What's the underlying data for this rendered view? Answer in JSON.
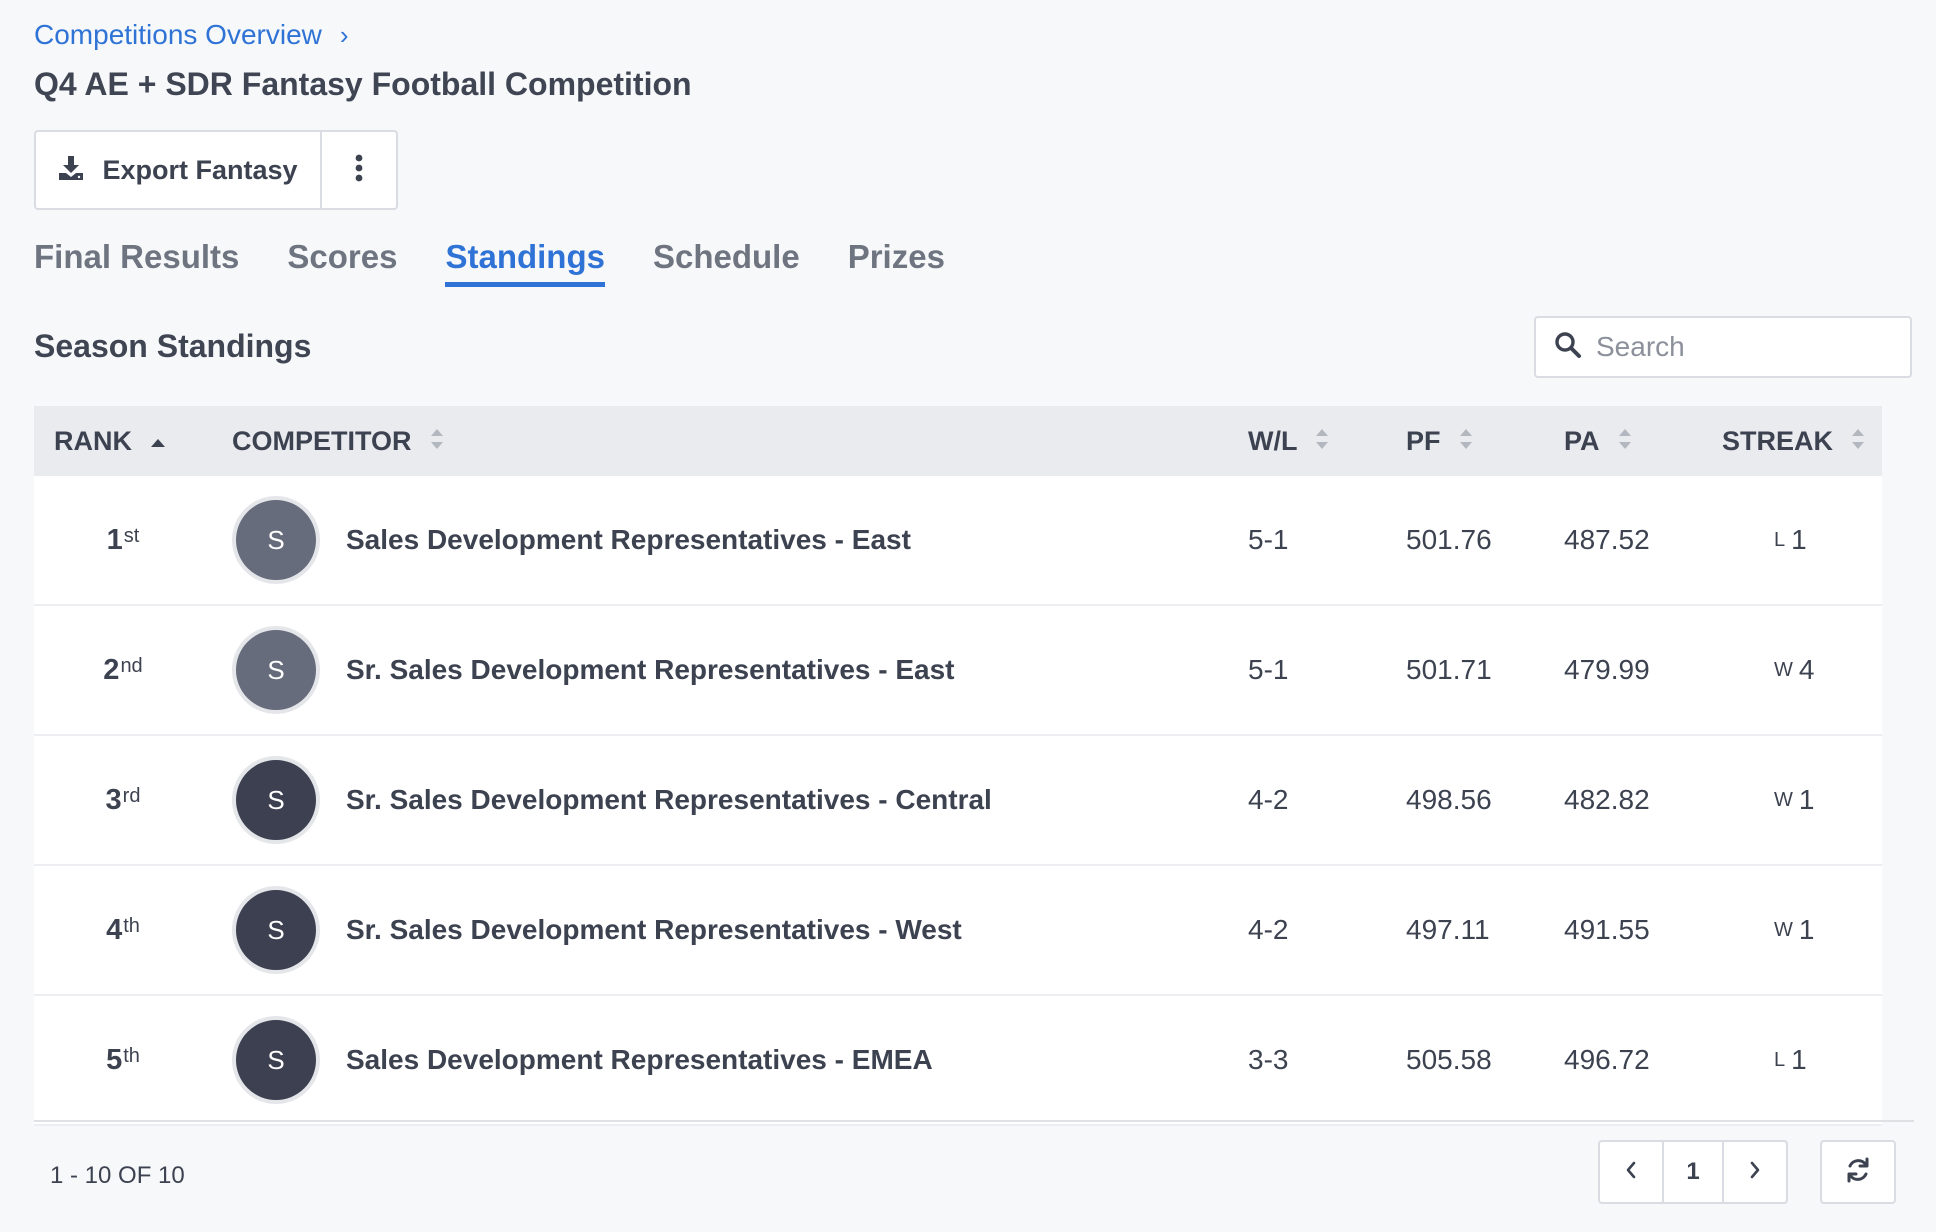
{
  "breadcrumb": {
    "link": "Competitions Overview",
    "separator": "›"
  },
  "page": {
    "title": "Q4 AE + SDR Fantasy Football Competition"
  },
  "actions": {
    "export_label": "Export Fantasy",
    "export_icon": "download-icon",
    "more_icon": "vertical-ellipsis-icon"
  },
  "tabs": [
    {
      "label": "Final Results",
      "active": false
    },
    {
      "label": "Scores",
      "active": false
    },
    {
      "label": "Standings",
      "active": true
    },
    {
      "label": "Schedule",
      "active": false
    },
    {
      "label": "Prizes",
      "active": false
    }
  ],
  "section": {
    "title": "Season Standings"
  },
  "search": {
    "placeholder": "Search",
    "value": ""
  },
  "table": {
    "columns": {
      "rank": "RANK",
      "competitor": "COMPETITOR",
      "wl": "W/L",
      "pf": "PF",
      "pa": "PA",
      "streak": "STREAK"
    },
    "rows": [
      {
        "rank": "1",
        "suffix": "st",
        "initial": "S",
        "avatar_color": "#676c7c",
        "name": "Sales Development Representatives - East",
        "wl": "5-1",
        "pf": "501.76",
        "pa": "487.52",
        "streak_type": "L",
        "streak_count": "1"
      },
      {
        "rank": "2",
        "suffix": "nd",
        "initial": "S",
        "avatar_color": "#676c7c",
        "name": "Sr. Sales Development Representatives - East",
        "wl": "5-1",
        "pf": "501.71",
        "pa": "479.99",
        "streak_type": "W",
        "streak_count": "4"
      },
      {
        "rank": "3",
        "suffix": "rd",
        "initial": "S",
        "avatar_color": "#3d4050",
        "name": "Sr. Sales Development Representatives - Central",
        "wl": "4-2",
        "pf": "498.56",
        "pa": "482.82",
        "streak_type": "W",
        "streak_count": "1"
      },
      {
        "rank": "4",
        "suffix": "th",
        "initial": "S",
        "avatar_color": "#3d4050",
        "name": "Sr. Sales Development Representatives - West",
        "wl": "4-2",
        "pf": "497.11",
        "pa": "491.55",
        "streak_type": "W",
        "streak_count": "1"
      },
      {
        "rank": "5",
        "suffix": "th",
        "initial": "S",
        "avatar_color": "#3d4050",
        "name": "Sales Development Representatives - EMEA",
        "wl": "3-3",
        "pf": "505.58",
        "pa": "496.72",
        "streak_type": "L",
        "streak_count": "1"
      }
    ]
  },
  "footer": {
    "range": "1 - 10 OF 10",
    "current_page": "1"
  },
  "colors": {
    "accent": "#2f73d6",
    "header_bg": "#e9ebef",
    "text": "#3c4250"
  }
}
